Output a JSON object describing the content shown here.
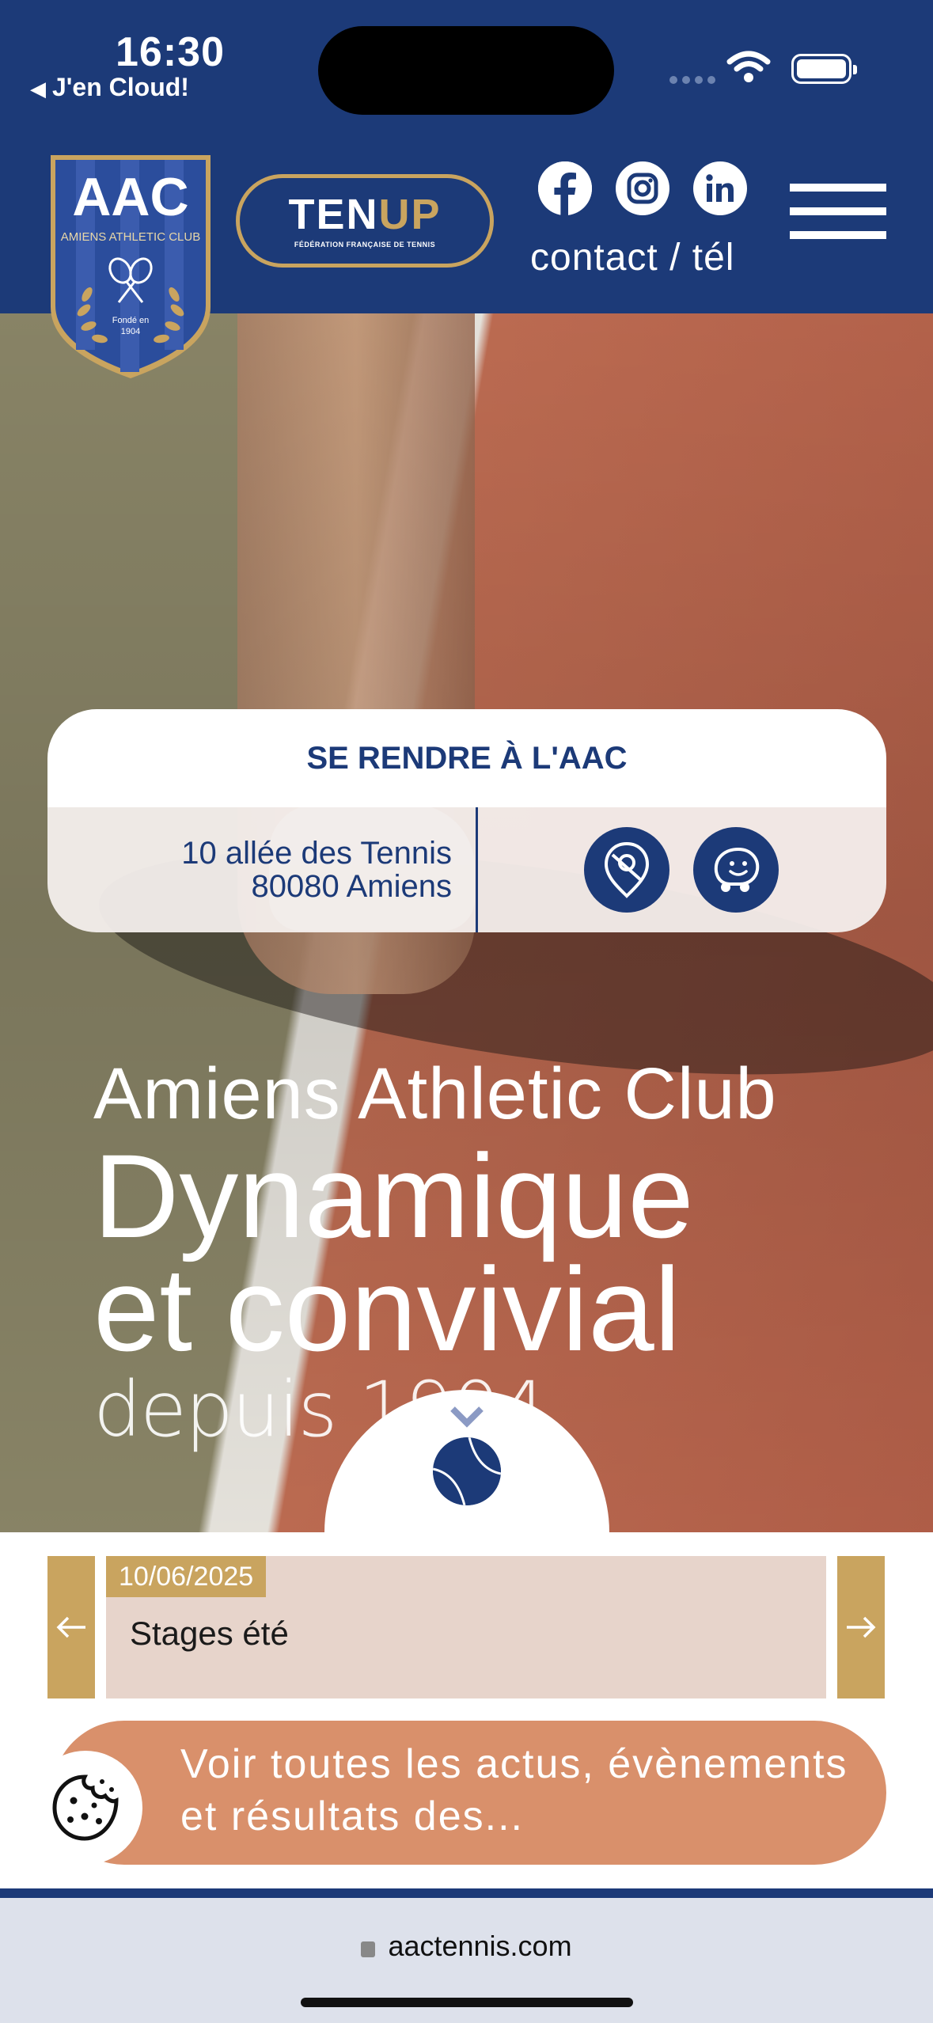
{
  "status_bar": {
    "time": "16:30",
    "back_app": "J'en Cloud!"
  },
  "header": {
    "logo": {
      "initials": "AAC",
      "club_name": "AMIENS ATHLETIC CLUB",
      "founded_line1": "Fondé en",
      "founded_line2": "1904"
    },
    "tenup": {
      "word_white": "TEN",
      "word_gold": "UP",
      "subtitle": "FÉDÉRATION FRANÇAISE DE TENNIS"
    },
    "social_icons": [
      "facebook-icon",
      "instagram-icon",
      "linkedin-icon"
    ],
    "contact_label": "contact / tél",
    "menu_icon": "hamburger-menu-icon"
  },
  "directions": {
    "title": "SE RENDRE À L'AAC",
    "address_line1": "10 allée des Tennis",
    "address_line2": "80080 Amiens",
    "buttons": [
      "maps-pin-icon",
      "waze-icon"
    ]
  },
  "hero": {
    "line1": "Amiens Athletic Club",
    "line2": "Dynamique",
    "line3": "et convivial",
    "line4": "depuis 1904"
  },
  "news": {
    "date": "10/06/2025",
    "title": "Stages été",
    "prev_icon": "arrow-left-icon",
    "next_icon": "arrow-right-icon"
  },
  "cta": {
    "label": "Voir toutes les actus, évènements et résultats des..."
  },
  "browser": {
    "url": "aactennis.com"
  },
  "colors": {
    "navy": "#1c3a78",
    "gold": "#c9a45f",
    "news_bg": "#e7d4cb",
    "cta_orange": "#d9906b"
  }
}
